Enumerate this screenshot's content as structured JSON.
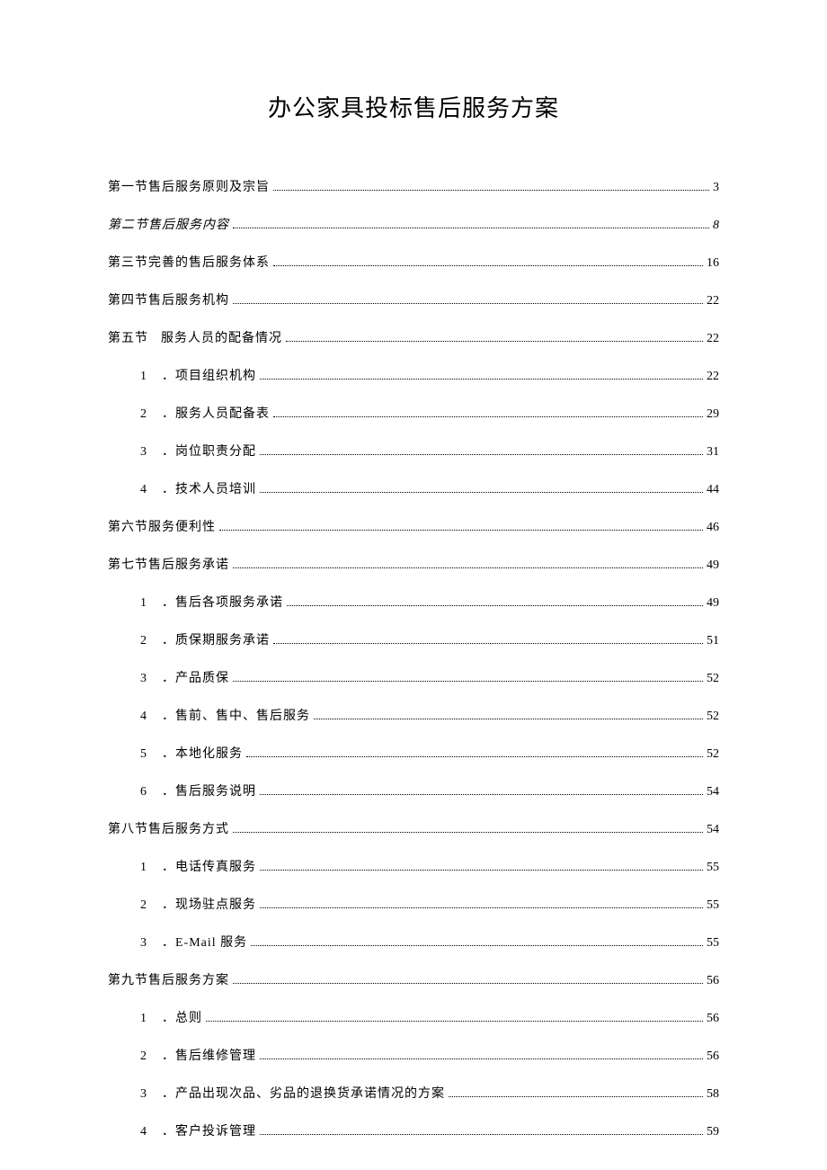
{
  "title": "办公家具投标售后服务方案",
  "toc": [
    {
      "level": 0,
      "num": "",
      "label": "第一节售后服务原则及宗旨",
      "page": "3",
      "italic": false
    },
    {
      "level": 0,
      "num": "",
      "label": "第二节售后服务内容",
      "page": "8",
      "italic": true
    },
    {
      "level": 0,
      "num": "",
      "label": "第三节完善的售后服务体系",
      "page": "16",
      "italic": false
    },
    {
      "level": 0,
      "num": "",
      "label": "第四节售后服务机构",
      "page": "22",
      "italic": false
    },
    {
      "level": 0,
      "num": "",
      "label": "第五节",
      "label2": "服务人员的配备情况",
      "page": "22",
      "italic": false,
      "gap": true
    },
    {
      "level": 1,
      "num": "1",
      "label": "．项目组织机构",
      "page": "22",
      "italic": false
    },
    {
      "level": 1,
      "num": "2",
      "label": "．服务人员配备表",
      "page": "29",
      "italic": false
    },
    {
      "level": 1,
      "num": "3",
      "label": "．岗位职责分配",
      "page": "31",
      "italic": false
    },
    {
      "level": 1,
      "num": "4",
      "label": "．技术人员培训",
      "page": "44",
      "italic": false
    },
    {
      "level": 0,
      "num": "",
      "label": "第六节服务便利性",
      "page": "46",
      "italic": false
    },
    {
      "level": 0,
      "num": "",
      "label": "第七节售后服务承诺",
      "page": "49",
      "italic": false
    },
    {
      "level": 1,
      "num": "1",
      "label": "．售后各项服务承诺",
      "page": "49",
      "italic": false
    },
    {
      "level": 1,
      "num": "2",
      "label": "．质保期服务承诺",
      "page": "51",
      "italic": false
    },
    {
      "level": 1,
      "num": "3",
      "label": "．产品质保",
      "page": "52",
      "italic": false
    },
    {
      "level": 1,
      "num": "4",
      "label": "．售前、售中、售后服务",
      "page": "52",
      "italic": false
    },
    {
      "level": 1,
      "num": "5",
      "label": "．本地化服务",
      "page": "52",
      "italic": false
    },
    {
      "level": 1,
      "num": "6",
      "label": "．售后服务说明",
      "page": "54",
      "italic": false
    },
    {
      "level": 0,
      "num": "",
      "label": "第八节售后服务方式",
      "page": "54",
      "italic": false
    },
    {
      "level": 1,
      "num": "1",
      "label": "．电话传真服务",
      "page": "55",
      "italic": false
    },
    {
      "level": 1,
      "num": "2",
      "label": "．现场驻点服务",
      "page": "55",
      "italic": false
    },
    {
      "level": 1,
      "num": "3",
      "label": "．E-Mail 服务",
      "page": "55",
      "italic": false
    },
    {
      "level": 0,
      "num": "",
      "label": "第九节售后服务方案",
      "page": "56",
      "italic": false
    },
    {
      "level": 1,
      "num": "1",
      "label": "．总则",
      "page": "56",
      "italic": false
    },
    {
      "level": 1,
      "num": "2",
      "label": "．售后维修管理",
      "page": "56",
      "italic": false
    },
    {
      "level": 1,
      "num": "3",
      "label": "．产品出现次品、劣品的退换货承诺情况的方案",
      "page": "58",
      "italic": false
    },
    {
      "level": 1,
      "num": "4",
      "label": "．客户投诉管理",
      "page": "59",
      "italic": false
    }
  ]
}
